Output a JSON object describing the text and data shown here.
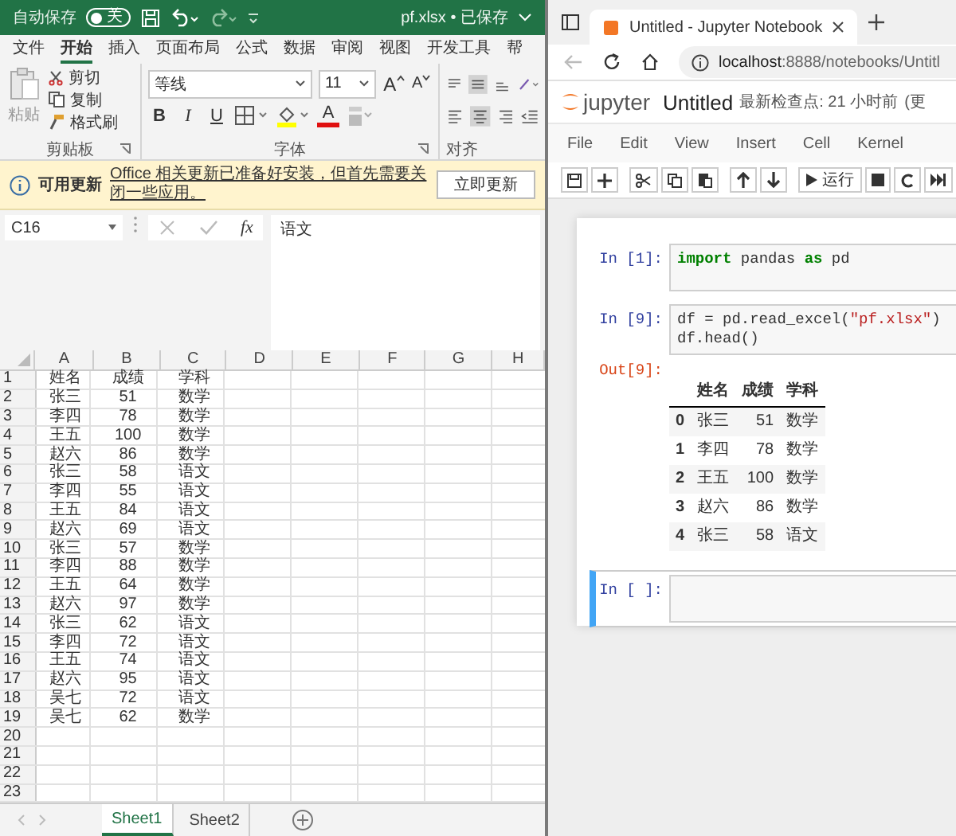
{
  "excel": {
    "title_bar": {
      "autosave_label": "自动保存",
      "autosave": {
        "on": false,
        "label": "关"
      },
      "filename": "pf.xlsx • 已保存"
    },
    "ribbon_tabs": [
      {
        "label": "文件",
        "selected": false
      },
      {
        "label": "开始",
        "selected": true
      },
      {
        "label": "插入",
        "selected": false
      },
      {
        "label": "页面布局",
        "selected": false
      },
      {
        "label": "公式",
        "selected": false
      },
      {
        "label": "数据",
        "selected": false
      },
      {
        "label": "审阅",
        "selected": false
      },
      {
        "label": "视图",
        "selected": false
      },
      {
        "label": "开发工具",
        "selected": false
      },
      {
        "label": "帮",
        "selected": false
      }
    ],
    "clipboard": {
      "paste": "粘贴",
      "cut": "剪切",
      "copy": "复制",
      "format_painter": "格式刷",
      "group_label": "剪贴板"
    },
    "font": {
      "name": "等线",
      "size": "11",
      "grow": "A",
      "shrink": "A",
      "bold": "B",
      "italic": "I",
      "underline": "U",
      "font_color": "A",
      "group_label": "字体"
    },
    "alignment": {
      "group_label": "对齐"
    },
    "info_bar": {
      "title": "可用更新",
      "message": "Office 相关更新已准备好安装，但首先需要关闭一些应用。",
      "button": "立即更新"
    },
    "formula_bar": {
      "cell_ref": "C16",
      "insert_function": "fx",
      "formula": "语文"
    },
    "sheet": {
      "columns": [
        "A",
        "B",
        "C",
        "D",
        "E",
        "F",
        "G",
        "H"
      ],
      "rows": [
        {
          "number": "1",
          "cells": [
            "姓名",
            "成绩",
            "学科"
          ]
        },
        {
          "number": "2",
          "cells": [
            "张三",
            "51",
            "数学"
          ]
        },
        {
          "number": "3",
          "cells": [
            "李四",
            "78",
            "数学"
          ]
        },
        {
          "number": "4",
          "cells": [
            "王五",
            "100",
            "数学"
          ]
        },
        {
          "number": "5",
          "cells": [
            "赵六",
            "86",
            "数学"
          ]
        },
        {
          "number": "6",
          "cells": [
            "张三",
            "58",
            "语文"
          ]
        },
        {
          "number": "7",
          "cells": [
            "李四",
            "55",
            "语文"
          ]
        },
        {
          "number": "8",
          "cells": [
            "王五",
            "84",
            "语文"
          ]
        },
        {
          "number": "9",
          "cells": [
            "赵六",
            "69",
            "语文"
          ]
        },
        {
          "number": "10",
          "cells": [
            "张三",
            "57",
            "数学"
          ]
        },
        {
          "number": "11",
          "cells": [
            "李四",
            "88",
            "数学"
          ]
        },
        {
          "number": "12",
          "cells": [
            "王五",
            "64",
            "数学"
          ]
        },
        {
          "number": "13",
          "cells": [
            "赵六",
            "97",
            "数学"
          ]
        },
        {
          "number": "14",
          "cells": [
            "张三",
            "62",
            "语文"
          ]
        },
        {
          "number": "15",
          "cells": [
            "李四",
            "72",
            "语文"
          ]
        },
        {
          "number": "16",
          "cells": [
            "王五",
            "74",
            "语文"
          ]
        },
        {
          "number": "17",
          "cells": [
            "赵六",
            "95",
            "语文"
          ]
        },
        {
          "number": "18",
          "cells": [
            "吴七",
            "72",
            "语文"
          ]
        },
        {
          "number": "19",
          "cells": [
            "吴七",
            "62",
            "数学"
          ]
        },
        {
          "number": "20"
        },
        {
          "number": "21"
        },
        {
          "number": "22"
        },
        {
          "number": "23"
        }
      ]
    },
    "sheet_tabs": [
      {
        "label": "Sheet1",
        "selected": true
      },
      {
        "label": "Sheet2",
        "selected": false
      }
    ]
  },
  "jupyter": {
    "browser": {
      "tab_title": "Untitled - Jupyter Notebook",
      "url_host": "localhost",
      "url_path": ":8888/notebooks/Untitl"
    },
    "header": {
      "logo_text": "jupyter",
      "notebook_name": "Untitled",
      "checkpoint": "最新检查点: 21 小时前",
      "autosave_status": "(更"
    },
    "menu": [
      "File",
      "Edit",
      "View",
      "Insert",
      "Cell",
      "Kernel"
    ],
    "run_label": "运行",
    "cells": [
      {
        "prompt": "In [1]:",
        "selected": false,
        "lines": [
          [
            {
              "t": "import",
              "kind": "keyword"
            },
            {
              "t": " pandas ",
              "kind": "plain"
            },
            {
              "t": "as",
              "kind": "keyword"
            },
            {
              "t": " pd",
              "kind": "plain"
            }
          ]
        ]
      },
      {
        "prompt": "In [9]:",
        "selected": false,
        "lines": [
          [
            {
              "t": "df = pd.read_excel(",
              "kind": "plain"
            },
            {
              "t": "\"pf.xlsx\"",
              "kind": "string"
            },
            {
              "t": ")",
              "kind": "plain"
            }
          ],
          [
            {
              "t": "df.head()",
              "kind": "plain"
            }
          ]
        ],
        "output": {
          "prompt": "Out[9]:",
          "columns": [
            "姓名",
            "成绩",
            "学科"
          ],
          "rows": [
            {
              "index": "0",
              "cells": [
                "张三",
                "51",
                "数学"
              ]
            },
            {
              "index": "1",
              "cells": [
                "李四",
                "78",
                "数学"
              ]
            },
            {
              "index": "2",
              "cells": [
                "王五",
                "100",
                "数学"
              ]
            },
            {
              "index": "3",
              "cells": [
                "赵六",
                "86",
                "数学"
              ]
            },
            {
              "index": "4",
              "cells": [
                "张三",
                "58",
                "语文"
              ]
            }
          ]
        }
      },
      {
        "prompt": "In [ ]:",
        "selected": true
      }
    ]
  }
}
